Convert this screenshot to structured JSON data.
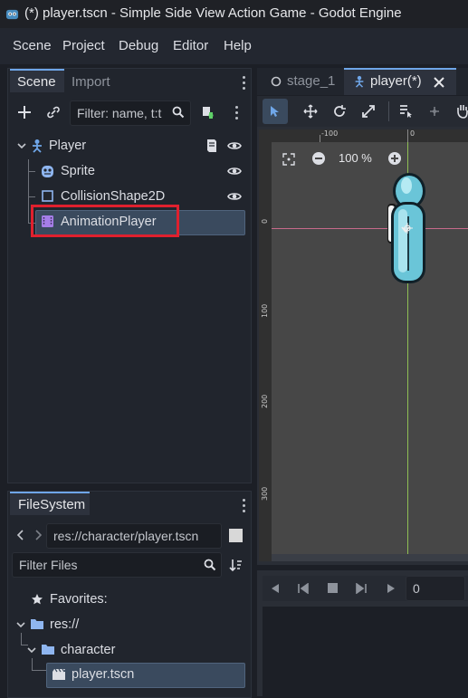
{
  "window": {
    "title": "(*) player.tscn - Simple Side View Action Game - Godot Engine"
  },
  "menu": [
    "Scene",
    "Project",
    "Debug",
    "Editor",
    "Help"
  ],
  "scene_dock": {
    "tabs": [
      "Scene",
      "Import"
    ],
    "filter_placeholder": "Filter: name, t:t",
    "tree": [
      {
        "label": "Player",
        "icon": "player-node-icon"
      },
      {
        "label": "Sprite",
        "icon": "sprite-node-icon"
      },
      {
        "label": "CollisionShape2D",
        "icon": "collision-shape-icon"
      },
      {
        "label": "AnimationPlayer",
        "icon": "animation-player-icon",
        "selected": true,
        "highlighted": true
      }
    ]
  },
  "filesystem_dock": {
    "tab": "FileSystem",
    "path": "res://character/player.tscn",
    "filter_placeholder": "Filter Files",
    "tree": [
      {
        "label": "Favorites:",
        "icon": "star-icon"
      },
      {
        "label": "res://",
        "icon": "folder-icon"
      },
      {
        "label": "character",
        "icon": "folder-icon"
      },
      {
        "label": "player.tscn",
        "icon": "scene-file-icon",
        "selected": true
      }
    ]
  },
  "editor_tabs": [
    {
      "label": "stage_1",
      "active": false
    },
    {
      "label": "player(*)",
      "active": true
    }
  ],
  "viewport": {
    "zoom": "100 %",
    "ruler_h": [
      "-100",
      "0"
    ],
    "ruler_v": [
      "0",
      "100",
      "200",
      "300"
    ]
  },
  "animation_panel": {
    "frame_value": "0"
  },
  "colors": {
    "accent": "#6fa6e8",
    "highlight_box": "#e0202e",
    "node_blue": "#6fa6e8",
    "anim_purple": "#a57ee8"
  }
}
